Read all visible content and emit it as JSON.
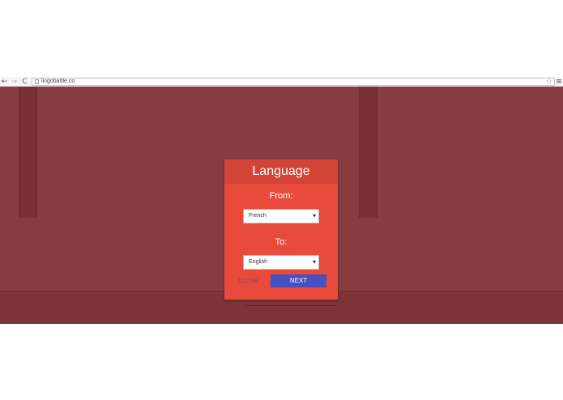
{
  "browser": {
    "back_icon": "←",
    "forward_icon": "→",
    "reload_icon": "C",
    "url": "lingobattle.co",
    "star_icon": "☆",
    "menu_icon": "≡"
  },
  "dialog": {
    "title": "Language",
    "from_label": "From:",
    "from_value": "French",
    "to_label": "To:",
    "to_value": "English",
    "dropdown_arrow": "▼",
    "close_label": "CLOSE",
    "next_label": "NEXT"
  },
  "colors": {
    "background": "#883c3f",
    "dialog": "#e84b3c",
    "dialog_header": "#d24436",
    "next_button": "#4650c0",
    "close_text": "#8e3d66"
  }
}
